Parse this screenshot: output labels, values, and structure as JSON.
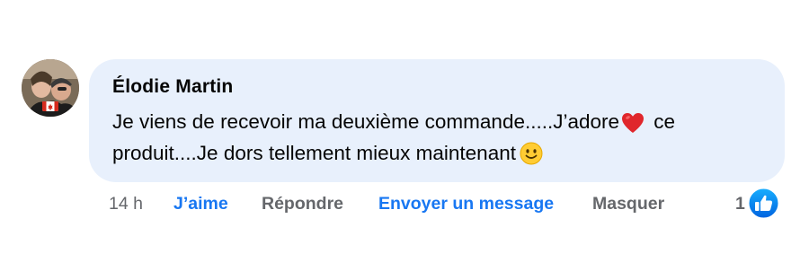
{
  "comment": {
    "author": "Élodie Martin",
    "text_part1": "Je viens de recevoir ma deuxième commande.....J’adore",
    "text_part2": "ce produit....Je dors tellement mieux maintenant",
    "heart_icon": "red-heart-emoji",
    "smile_icon": "slightly-smiling-face-emoji"
  },
  "actions": {
    "time": "14 h",
    "like_label": "J’aime",
    "reply_label": "Répondre",
    "message_label": "Envoyer un message",
    "hide_label": "Masquer"
  },
  "reactions": {
    "count": "1",
    "icon": "like-thumb-icon"
  },
  "colors": {
    "bubble": "#e8f0fc",
    "accent": "#1877f2",
    "muted": "#65676b",
    "text": "#050505"
  }
}
